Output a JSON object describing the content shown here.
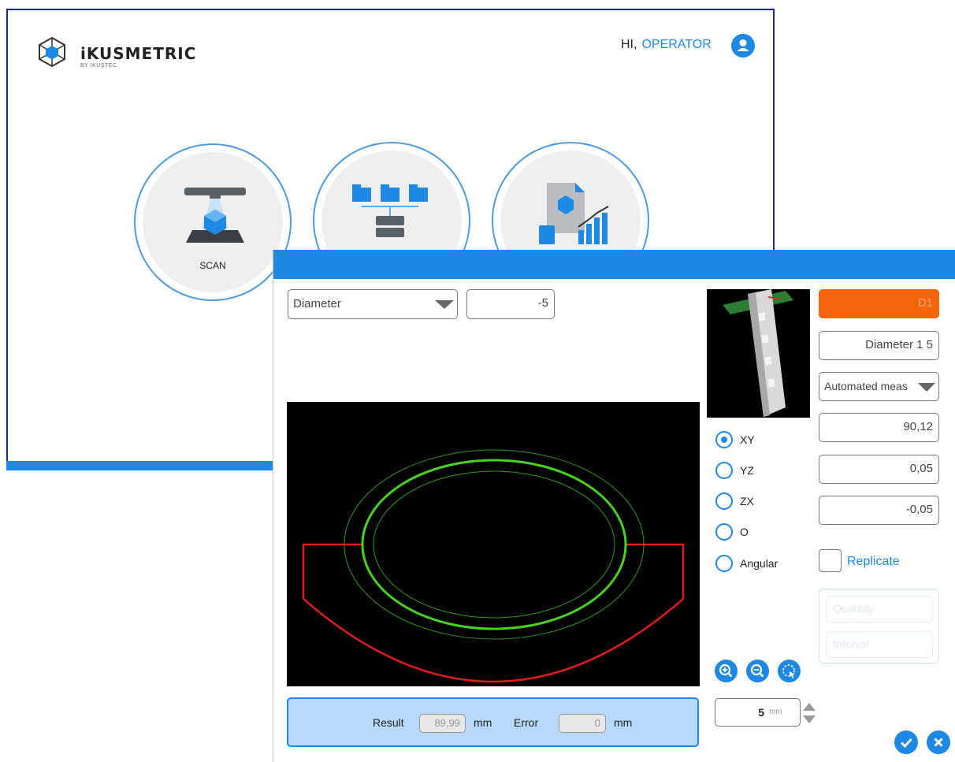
{
  "header": {
    "brand": "iKUSMETRIC",
    "brand_sub": "BY IKUSTEC",
    "greeting": "HI,",
    "user": "OPERATOR"
  },
  "home_tiles": [
    {
      "label": "SCAN",
      "icon": "scanner-icon"
    },
    {
      "label": "",
      "icon": "network-folders-icon"
    },
    {
      "label": "",
      "icon": "report-chart-icon"
    }
  ],
  "dialog": {
    "measure_type": "Diameter",
    "offset_value": "-5",
    "feature_id": "D1",
    "feature_name": "Diameter 1 5",
    "mode": "Automated meas",
    "nominal": "90,12",
    "tol_upper": "0,05",
    "tol_lower": "-0,05",
    "planes": [
      {
        "label": "XY",
        "selected": true
      },
      {
        "label": "YZ",
        "selected": false
      },
      {
        "label": "ZX",
        "selected": false
      },
      {
        "label": "O",
        "selected": false
      },
      {
        "label": "Angular",
        "selected": false
      }
    ],
    "replicate_label": "Replicate",
    "replicate_checked": false,
    "quantity_placeholder": "Quantity",
    "interval_placeholder": "Interval",
    "step_value": "5",
    "step_unit": "mm",
    "result_label": "Result",
    "result_value": "89,99",
    "result_unit": "mm",
    "error_label": "Error",
    "error_value": "0",
    "error_unit": "mm"
  },
  "colors": {
    "accent": "#1e88e5",
    "feature_id_bg": "#f4640a",
    "result_bar_bg": "#b7d9fb",
    "profile_red": "#e01b1b",
    "fit_green": "#46d21e"
  }
}
